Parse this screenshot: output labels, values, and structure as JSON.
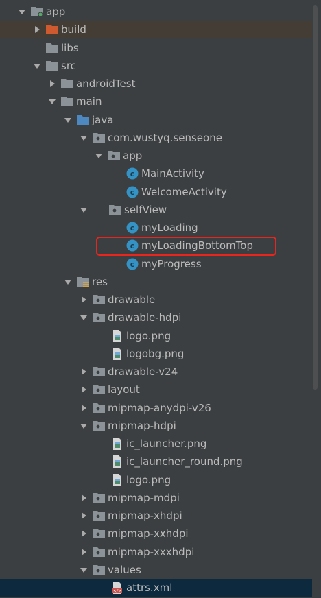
{
  "tree": {
    "items": [
      {
        "label": "app",
        "arrow": "down",
        "icon": "module-folder-icon"
      },
      {
        "label": "build",
        "arrow": "right",
        "icon": "excluded-folder-icon"
      },
      {
        "label": "libs",
        "arrow": "none",
        "icon": "folder-icon"
      },
      {
        "label": "src",
        "arrow": "down",
        "icon": "folder-icon"
      },
      {
        "label": "androidTest",
        "arrow": "right",
        "icon": "folder-icon"
      },
      {
        "label": "main",
        "arrow": "down",
        "icon": "folder-icon"
      },
      {
        "label": "java",
        "arrow": "down",
        "icon": "source-folder-icon"
      },
      {
        "label": "com.wustyq.senseone",
        "arrow": "down",
        "icon": "package-icon"
      },
      {
        "label": "app",
        "arrow": "down",
        "icon": "package-icon"
      },
      {
        "label": "MainActivity",
        "arrow": "none",
        "icon": "class-icon"
      },
      {
        "label": "WelcomeActivity",
        "arrow": "none",
        "icon": "class-icon"
      },
      {
        "label": "selfView",
        "arrow": "down",
        "icon": "package-icon"
      },
      {
        "label": "myLoading",
        "arrow": "none",
        "icon": "class-icon"
      },
      {
        "label": "myLoadingBottomTop",
        "arrow": "none",
        "icon": "class-icon"
      },
      {
        "label": "myProgress",
        "arrow": "none",
        "icon": "class-icon"
      },
      {
        "label": "res",
        "arrow": "down",
        "icon": "resource-folder-icon"
      },
      {
        "label": "drawable",
        "arrow": "right",
        "icon": "package-icon"
      },
      {
        "label": "drawable-hdpi",
        "arrow": "down",
        "icon": "package-icon"
      },
      {
        "label": "logo.png",
        "arrow": "none",
        "icon": "image-file-icon"
      },
      {
        "label": "logobg.png",
        "arrow": "none",
        "icon": "image-file-icon"
      },
      {
        "label": "drawable-v24",
        "arrow": "right",
        "icon": "package-icon"
      },
      {
        "label": "layout",
        "arrow": "right",
        "icon": "package-icon"
      },
      {
        "label": "mipmap-anydpi-v26",
        "arrow": "right",
        "icon": "package-icon"
      },
      {
        "label": "mipmap-hdpi",
        "arrow": "down",
        "icon": "package-icon"
      },
      {
        "label": "ic_launcher.png",
        "arrow": "none",
        "icon": "image-file-icon"
      },
      {
        "label": "ic_launcher_round.png",
        "arrow": "none",
        "icon": "image-file-icon"
      },
      {
        "label": "logo.png",
        "arrow": "none",
        "icon": "image-file-icon"
      },
      {
        "label": "mipmap-mdpi",
        "arrow": "right",
        "icon": "package-icon"
      },
      {
        "label": "mipmap-xhdpi",
        "arrow": "right",
        "icon": "package-icon"
      },
      {
        "label": "mipmap-xxhdpi",
        "arrow": "right",
        "icon": "package-icon"
      },
      {
        "label": "mipmap-xxxhdpi",
        "arrow": "right",
        "icon": "package-icon"
      },
      {
        "label": "values",
        "arrow": "down",
        "icon": "package-icon"
      },
      {
        "label": "attrs.xml",
        "arrow": "none",
        "icon": "xml-file-icon"
      }
    ]
  },
  "colors": {
    "background": "#3c3f41",
    "text": "#bbbbbb",
    "highlight_row": "#443d36",
    "selected_row": "#0d293e",
    "annotation_box": "#e8261e",
    "class_icon": "#3592c4",
    "folder": "#8c9398",
    "source_folder": "#4d88c0",
    "excluded_folder": "#d05a2f"
  }
}
